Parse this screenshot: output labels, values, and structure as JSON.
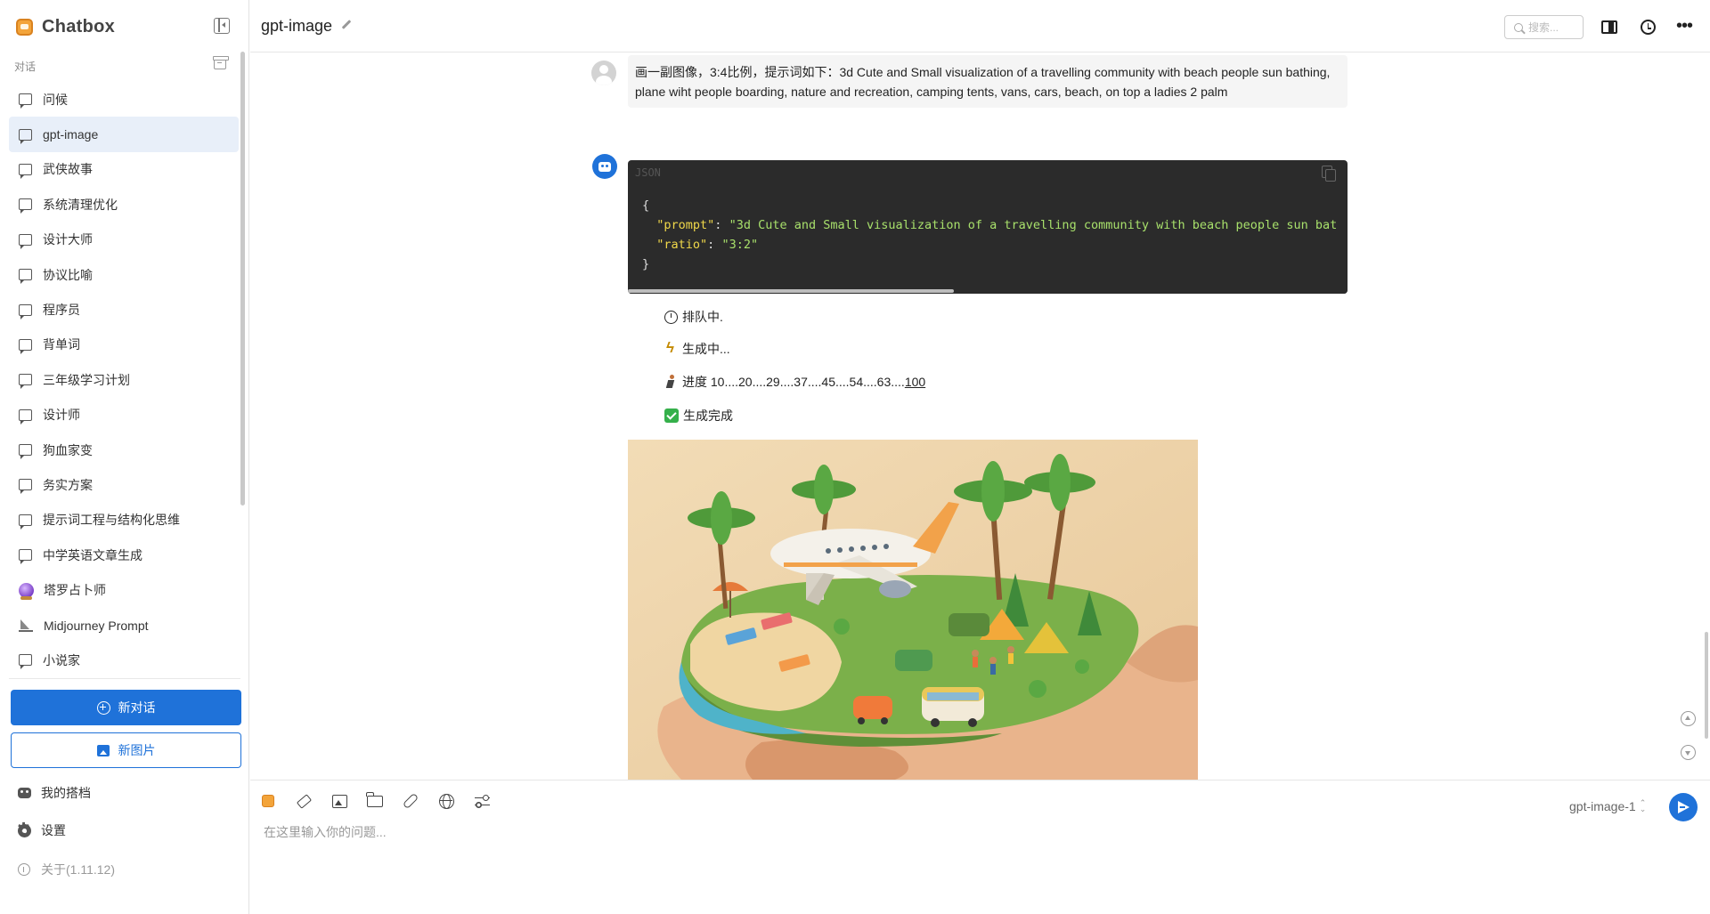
{
  "app": {
    "name": "Chatbox"
  },
  "sidebar": {
    "section_label": "对话",
    "conversations": [
      {
        "label": "问候",
        "icon": "chat-bubble-icon"
      },
      {
        "label": "gpt-image",
        "icon": "chat-bubble-icon",
        "active": true
      },
      {
        "label": "武侠故事",
        "icon": "chat-bubble-icon"
      },
      {
        "label": "系统清理优化",
        "icon": "chat-bubble-icon"
      },
      {
        "label": "设计大师",
        "icon": "chat-bubble-icon"
      },
      {
        "label": "协议比喻",
        "icon": "chat-bubble-icon"
      },
      {
        "label": "程序员",
        "icon": "chat-bubble-icon"
      },
      {
        "label": "背单词",
        "icon": "chat-bubble-icon"
      },
      {
        "label": "三年级学习计划",
        "icon": "chat-bubble-icon"
      },
      {
        "label": "设计师",
        "icon": "chat-bubble-icon"
      },
      {
        "label": "狗血家变",
        "icon": "chat-bubble-icon"
      },
      {
        "label": "务实方案",
        "icon": "chat-bubble-icon"
      },
      {
        "label": "提示词工程与结构化思维",
        "icon": "chat-bubble-icon"
      },
      {
        "label": "中学英语文章生成",
        "icon": "chat-bubble-icon"
      },
      {
        "label": "塔罗占卜师",
        "icon": "crystal-ball-icon"
      },
      {
        "label": "Midjourney Prompt",
        "icon": "sailboat-icon"
      },
      {
        "label": "小说家",
        "icon": "chat-bubble-icon"
      }
    ],
    "new_chat_label": "新对话",
    "new_image_label": "新图片",
    "my_partner_label": "我的搭档",
    "settings_label": "设置",
    "about_label": "关于(1.11.12)"
  },
  "header": {
    "title": "gpt-image",
    "search_placeholder": "搜索..."
  },
  "messages": {
    "user_prompt": "画一副图像，3:4比例，提示词如下：3d Cute and Small visualization of a travelling community with beach people sun bathing, plane wiht people boarding, nature and recreation, camping tents, vans, cars, beach, on top a ladies 2 palm",
    "code_lang": "JSON",
    "code": {
      "open": "{",
      "prompt_key": "\"prompt\"",
      "prompt_value": "\"3d Cute and Small visualization of a travelling community with beach people sun bat",
      "ratio_key": "\"ratio\"",
      "ratio_value": "\"3:2\"",
      "close": "}"
    },
    "status": {
      "queued": "排队中.",
      "generating": "生成中...",
      "progress_prefix": "进度 10....20....29....37....45....54....63....",
      "progress_last": "100",
      "done": "生成完成"
    }
  },
  "composer": {
    "placeholder": "在这里输入你的问题...",
    "model": "gpt-image-1"
  },
  "colors": {
    "accent": "#1f72d9",
    "active_item_bg": "#e8eff9",
    "code_bg": "#2b2b2b",
    "success": "#35b04b"
  }
}
